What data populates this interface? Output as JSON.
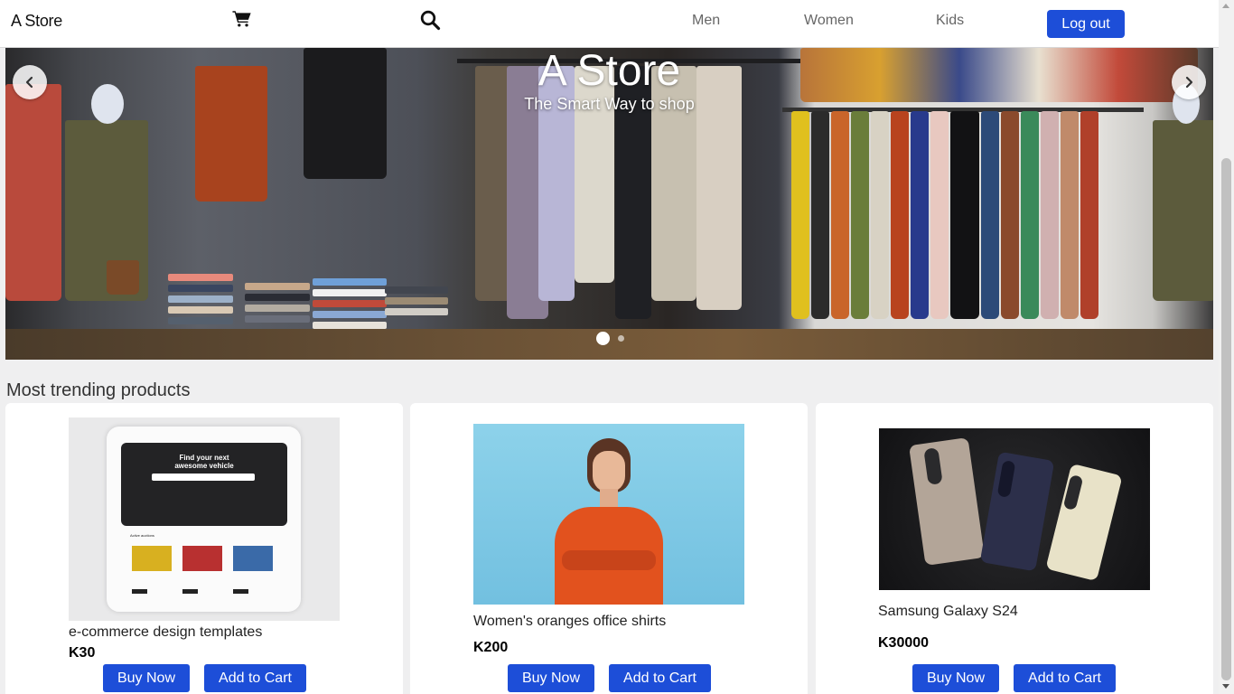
{
  "navbar": {
    "brand": "A Store",
    "cart_icon": "shopping-cart-icon",
    "search_icon": "search-icon",
    "links": [
      "Men",
      "Women",
      "Kids"
    ],
    "logout_label": "Log out"
  },
  "hero": {
    "title": "A Store",
    "subtitle": "The Smart Way to shop",
    "slides_count": 2,
    "active_slide": 1,
    "prev_icon": "chevron-left-icon",
    "next_icon": "chevron-right-icon"
  },
  "section_title": "Most trending products",
  "products": [
    {
      "name": "e-commerce design templates",
      "price": "K30",
      "buy_label": "Buy Now",
      "cart_label": "Add to Cart",
      "image_text": {
        "headline": "Find your next awesome vehicle",
        "subheading": "Active auctions"
      }
    },
    {
      "name": "Women's oranges office shirts",
      "price": "K200",
      "buy_label": "Buy Now",
      "cart_label": "Add to Cart"
    },
    {
      "name": "Samsung Galaxy S24",
      "price": "K30000",
      "buy_label": "Buy Now",
      "cart_label": "Add to Cart"
    }
  ],
  "colors": {
    "accent": "#1d4ed8",
    "background": "#efeff0",
    "navbar": "#ffffff"
  }
}
